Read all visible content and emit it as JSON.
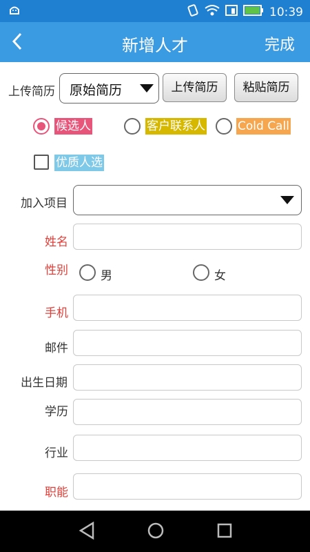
{
  "status_bar": {
    "time": "10:39",
    "icons": [
      "android-icon",
      "vibrate-icon",
      "wifi-icon",
      "signal-icon",
      "battery-icon"
    ]
  },
  "app_bar": {
    "title": "新增人才",
    "done_label": "完成",
    "back_icon": "chevron-left-icon"
  },
  "resume": {
    "label": "上传简历",
    "select_value": "原始简历",
    "upload_button": "上传简历",
    "paste_button": "粘贴简历"
  },
  "type_options": [
    {
      "label": "候选人",
      "checked": true,
      "color": "#e8557a"
    },
    {
      "label": "客户联系人",
      "checked": false,
      "color": "#d6b800"
    },
    {
      "label": "Cold Call",
      "checked": false,
      "color": "#f5a64e"
    }
  ],
  "quality": {
    "label": "优质人选",
    "checked": false,
    "color": "#7ec8e8"
  },
  "project": {
    "label": "加入项目",
    "value": ""
  },
  "fields": {
    "name": {
      "label": "姓名",
      "value": "",
      "required": true
    },
    "gender": {
      "label": "性别",
      "required": true,
      "options": [
        "男",
        "女"
      ]
    },
    "mobile": {
      "label": "手机",
      "value": "",
      "required": true
    },
    "email": {
      "label": "邮件",
      "value": ""
    },
    "birthday": {
      "label": "出生日期",
      "value": ""
    },
    "education": {
      "label": "学历",
      "value": ""
    },
    "industry": {
      "label": "行业",
      "value": ""
    },
    "function": {
      "label": "职能",
      "value": "",
      "required": true
    }
  },
  "colors": {
    "accent": "#3a9ae2",
    "required": "#e0403a"
  }
}
